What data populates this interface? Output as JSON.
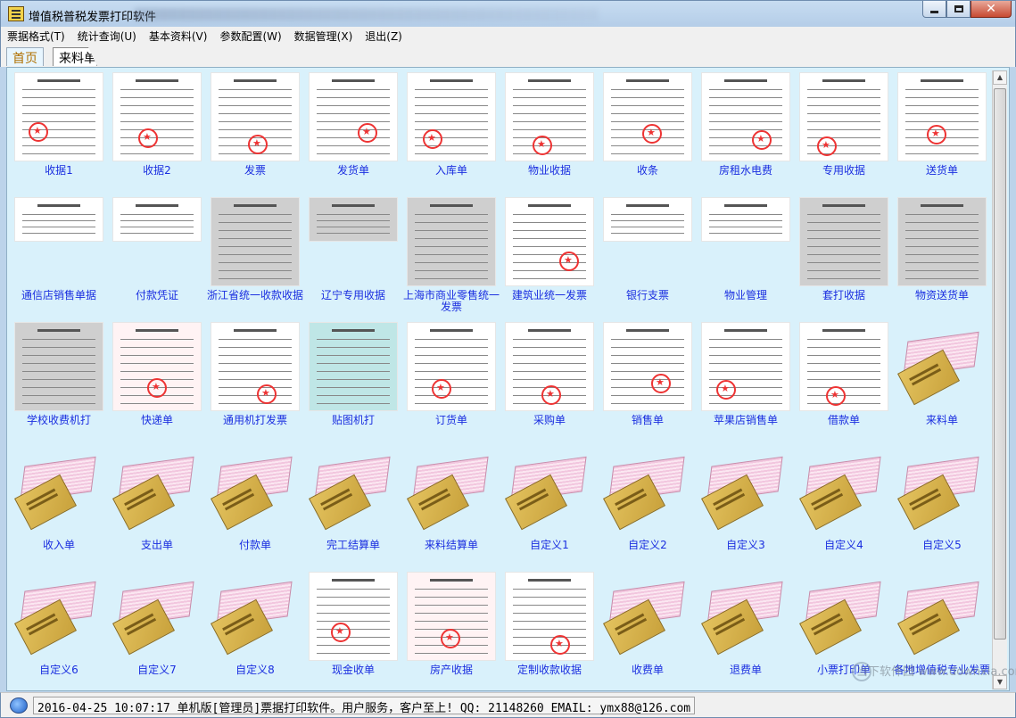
{
  "window": {
    "title": "增值税普税发票打印软件",
    "colors": {
      "label": "#1a2ee0",
      "content_bg": "#d9f1fb"
    }
  },
  "menu": [
    "票据格式(T)",
    "统计查询(U)",
    "基本资料(V)",
    "参数配置(W)",
    "数据管理(X)",
    "退出(Z)"
  ],
  "tabs": [
    {
      "label": "首页",
      "active": true
    },
    {
      "label": "来料单",
      "active": false
    }
  ],
  "templates": [
    {
      "label": "收据1",
      "thumb": "doc"
    },
    {
      "label": "收据2",
      "thumb": "doc"
    },
    {
      "label": "发票",
      "thumb": "doc"
    },
    {
      "label": "发货单",
      "thumb": "doc"
    },
    {
      "label": "入库单",
      "thumb": "doc"
    },
    {
      "label": "物业收据",
      "thumb": "doc"
    },
    {
      "label": "收条",
      "thumb": "doc"
    },
    {
      "label": "房租水电费",
      "thumb": "doc"
    },
    {
      "label": "专用收据",
      "thumb": "doc"
    },
    {
      "label": "送货单",
      "thumb": "doc"
    },
    {
      "label": "通信店销售单据",
      "thumb": "doc-short"
    },
    {
      "label": "付款凭证",
      "thumb": "doc-short"
    },
    {
      "label": "浙江省统一收款收据",
      "thumb": "doc-grey"
    },
    {
      "label": "辽宁专用收据",
      "thumb": "doc-grey-short"
    },
    {
      "label": "上海市商业零售统一发票",
      "thumb": "doc-grey"
    },
    {
      "label": "建筑业统一发票",
      "thumb": "doc"
    },
    {
      "label": "银行支票",
      "thumb": "doc-short"
    },
    {
      "label": "物业管理",
      "thumb": "doc-short"
    },
    {
      "label": "套打收据",
      "thumb": "doc-grey"
    },
    {
      "label": "物资送货单",
      "thumb": "doc-grey"
    },
    {
      "label": "学校收费机打",
      "thumb": "doc-grey"
    },
    {
      "label": "快递单",
      "thumb": "doc-pink"
    },
    {
      "label": "通用机打发票",
      "thumb": "doc"
    },
    {
      "label": "贴图机打",
      "thumb": "doc-teal"
    },
    {
      "label": "订货单",
      "thumb": "doc"
    },
    {
      "label": "采购单",
      "thumb": "doc"
    },
    {
      "label": "销售单",
      "thumb": "doc"
    },
    {
      "label": "苹果店销售单",
      "thumb": "doc"
    },
    {
      "label": "借款单",
      "thumb": "doc"
    },
    {
      "label": "来料单",
      "thumb": "book"
    },
    {
      "label": "收入单",
      "thumb": "book"
    },
    {
      "label": "支出单",
      "thumb": "book"
    },
    {
      "label": "付款单",
      "thumb": "book"
    },
    {
      "label": "完工结算单",
      "thumb": "book"
    },
    {
      "label": "来料结算单",
      "thumb": "book"
    },
    {
      "label": "自定义1",
      "thumb": "book"
    },
    {
      "label": "自定义2",
      "thumb": "book"
    },
    {
      "label": "自定义3",
      "thumb": "book"
    },
    {
      "label": "自定义4",
      "thumb": "book"
    },
    {
      "label": "自定义5",
      "thumb": "book"
    },
    {
      "label": "自定义6",
      "thumb": "book"
    },
    {
      "label": "自定义7",
      "thumb": "book"
    },
    {
      "label": "自定义8",
      "thumb": "book"
    },
    {
      "label": "现金收单",
      "thumb": "doc"
    },
    {
      "label": "房产收据",
      "thumb": "doc-pink"
    },
    {
      "label": "定制收款收据",
      "thumb": "doc"
    },
    {
      "label": "收费单",
      "thumb": "book"
    },
    {
      "label": "退费单",
      "thumb": "book"
    },
    {
      "label": "小票打印单",
      "thumb": "book"
    },
    {
      "label": "各地增值税专业发票",
      "thumb": "book"
    }
  ],
  "status": {
    "text": "2016-04-25 10:07:17 单机版[管理员]票据打印软件。用户服务，客户至上!  QQ: 21148260  EMAIL: ymx88@126.com"
  },
  "watermark": "当下软件园 www.downxia.com"
}
